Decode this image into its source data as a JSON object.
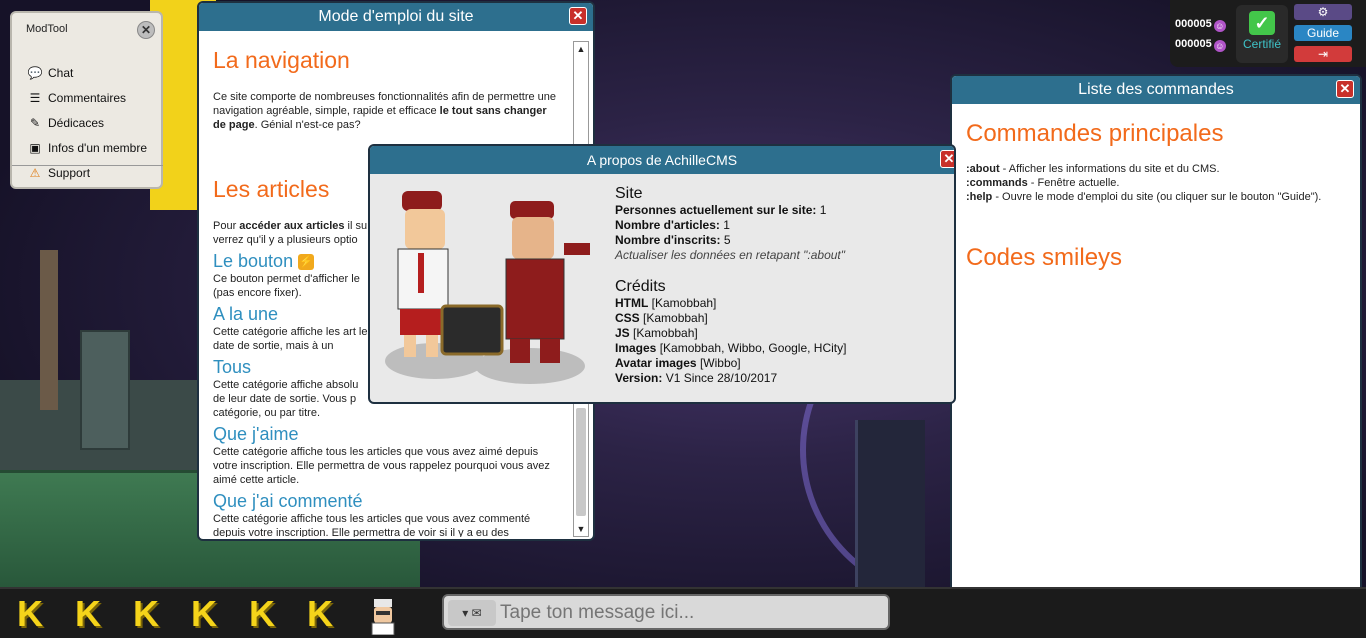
{
  "modtool": {
    "title": "ModTool",
    "items": [
      {
        "label": "Chat"
      },
      {
        "label": "Commentaires"
      },
      {
        "label": "Dédicaces"
      },
      {
        "label": "Infos d'un membre"
      },
      {
        "label": "Support"
      }
    ]
  },
  "hud": {
    "currency1": "000005",
    "currency2": "000005",
    "certified": "Certifié",
    "guide_label": "Guide",
    "colors": {
      "settings": "#5a4a86",
      "guide": "#2a86c4",
      "logout": "#d23b3b"
    }
  },
  "guide_window": {
    "title": "Mode d'emploi du site",
    "h1_navigation": "La navigation",
    "nav_text_a": "Ce site comporte de nombreuses fonctionnalités afin de permettre une navigation agréable, simple, rapide et efficace ",
    "nav_text_b": "le tout sans changer de page",
    "nav_text_c": ". Génial n'est-ce pas?",
    "h1_articles": "Les articles",
    "articles_a": "Pour ",
    "articles_b": "accéder aux articles",
    "articles_c": " il su",
    "articles_d": "verrez qu'il y a plusieurs optio",
    "h2_bouton": "Le bouton",
    "bouton_text": "Ce bouton permet d'afficher le (pas encore fixer).",
    "h2_une": "A la une",
    "une_text": "Cette catégorie affiche les art leur date de sortie, mais à un",
    "h2_tous": "Tous",
    "tous_text": "Cette catégorie affiche absolu de leur date de sortie. Vous p catégorie, ou par titre.",
    "h2_aime": "Que j'aime",
    "aime_text": "Cette catégorie affiche tous les articles que vous avez aimé depuis votre inscription. Elle permettra de vous rappelez pourquoi vous avez aimé cette article.",
    "h2_commente": "Que j'ai commenté",
    "commente_text": "Cette catégorie affiche tous les articles que vous avez commenté depuis votre inscription. Elle permettra de voir si il y a eu des"
  },
  "about_window": {
    "title": "A propos de AchilleCMS",
    "site_heading": "Site",
    "persons_label": "Personnes actuellement sur le site:",
    "persons_value": "1",
    "articles_label": "Nombre d'articles:",
    "articles_value": "1",
    "registered_label": "Nombre d'inscrits:",
    "registered_value": "5",
    "refresh_note": "Actualiser les données en retapant \":about\"",
    "credits_heading": "Crédits",
    "credits": [
      {
        "label": "HTML",
        "value": "[Kamobbah]"
      },
      {
        "label": "CSS",
        "value": "[Kamobbah]"
      },
      {
        "label": "JS",
        "value": "[Kamobbah]"
      },
      {
        "label": "Images",
        "value": "[Kamobbah, Wibbo, Google, HCity]"
      },
      {
        "label": "Avatar images",
        "value": "[Wibbo]"
      },
      {
        "label": "Version:",
        "value": "V1 Since 28/10/2017"
      }
    ]
  },
  "commands_window": {
    "title": "Liste des commandes",
    "h1_main": "Commandes principales",
    "commands": [
      {
        "cmd": ":about",
        "desc": " - Afficher les informations du site et du CMS."
      },
      {
        "cmd": ":commands",
        "desc": " - Fenêtre actuelle."
      },
      {
        "cmd": ":help",
        "desc": " - Ouvre le mode d'emploi du site (ou cliquer sur le bouton \"Guide\")."
      }
    ],
    "h1_smileys": "Codes smileys"
  },
  "bottom_bar": {
    "k_slots": [
      "K",
      "K",
      "K",
      "K",
      "K",
      "K"
    ],
    "chat_placeholder": "Tape ton message ici..."
  }
}
